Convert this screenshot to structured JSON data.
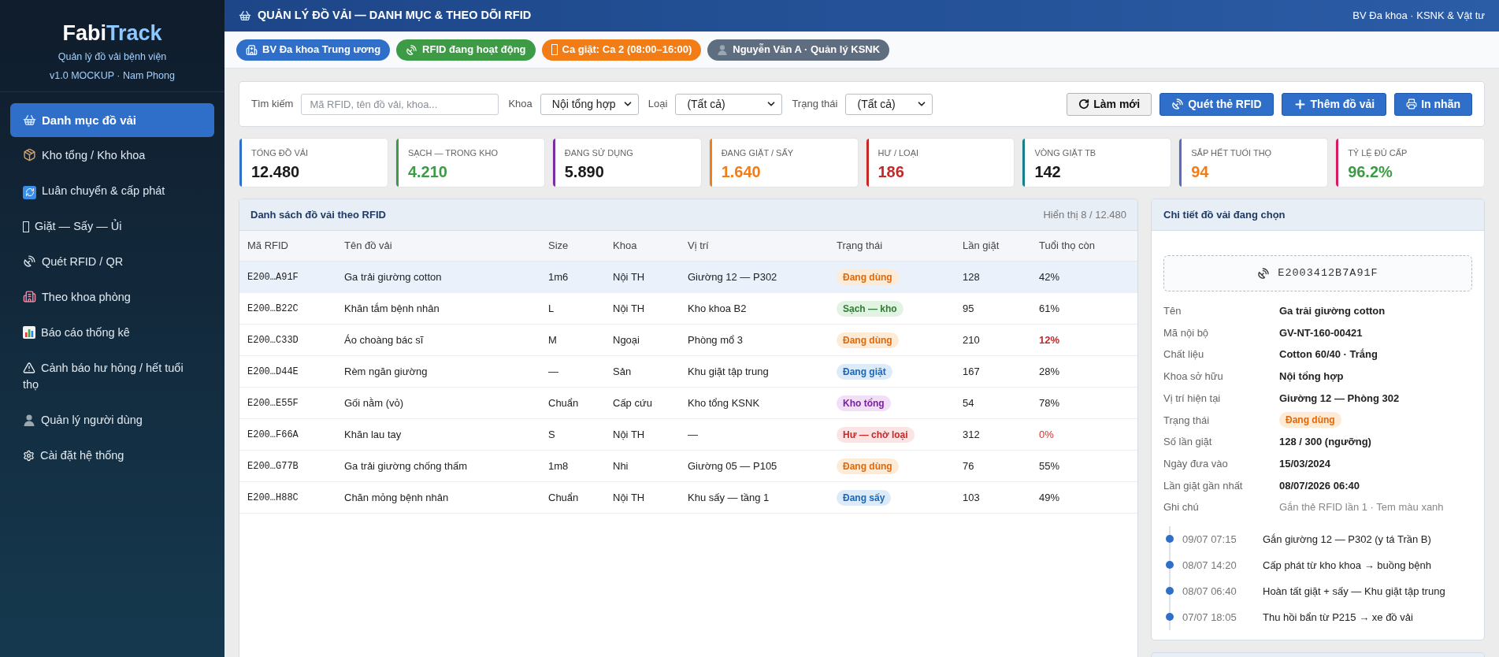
{
  "sidebar": {
    "logo": {
      "text_1": "Fabi",
      "text_2": "Track"
    },
    "subtitle": "Quản lý đồ vải bệnh viện",
    "version": "v1.0 MOCKUP · Nam Phong",
    "items": [
      {
        "label": "Danh mục đồ vải",
        "selected": true
      },
      {
        "label": "Kho tổng / Kho khoa",
        "selected": false
      },
      {
        "label": "Luân chuyển & cấp phát",
        "selected": false
      },
      {
        "label": "Giặt — Sấy — Ủi",
        "selected": false
      },
      {
        "label": "Quét RFID / QR",
        "selected": false
      },
      {
        "label": "Theo khoa phòng",
        "selected": false
      },
      {
        "label": "Báo cáo thống kê",
        "selected": false
      },
      {
        "label": "Cảnh báo hư hỏng / hết tuổi thọ",
        "selected": false
      },
      {
        "label": "Quản lý người dùng",
        "selected": false
      },
      {
        "label": "Cài đặt hệ thống",
        "selected": false
      }
    ]
  },
  "header": {
    "title": "QUẢN LÝ ĐỒ VẢI — DANH MỤC & THEO DÕI RFID",
    "context": "BV Đa khoa · KSNK & Vật tư"
  },
  "chips": [
    {
      "label": "BV Đa khoa Trung ương",
      "color": "#2f6fca"
    },
    {
      "label": "RFID đang hoạt động",
      "color": "#3d9b46"
    },
    {
      "label": "Ca giặt: Ca 2 (08:00–16:00)",
      "color": "#f27d17"
    },
    {
      "label": "Nguyễn Văn A · Quản lý KSNK",
      "color": "#5f6d80"
    }
  ],
  "filters": {
    "search": {
      "label": "Tìm kiếm",
      "placeholder": "Mã RFID, tên đồ vải, khoa..."
    },
    "selects": [
      {
        "label": "Khoa",
        "value": "Nội tổng hợp"
      },
      {
        "label": "Loại",
        "value": "(Tất cả)"
      },
      {
        "label": "Trạng thái",
        "value": "(Tất cả)"
      }
    ],
    "buttons": [
      {
        "label": "Làm mới",
        "kind": "secondary"
      },
      {
        "label": "Quét thẻ RFID",
        "kind": "primary"
      },
      {
        "label": "Thêm đồ vải",
        "kind": "primary"
      },
      {
        "label": "In nhãn",
        "kind": "primary"
      }
    ]
  },
  "stats": [
    {
      "label": "TỔNG ĐỒ VẢI",
      "value": {
        "text": "12.480",
        "color": "#1a1a1a"
      },
      "color": "#2f6fca"
    },
    {
      "label": "SẠCH — TRONG KHO",
      "value": {
        "text": "4.210",
        "color": "#3d9b46"
      },
      "color": "#3d9b46"
    },
    {
      "label": "ĐANG SỬ DỤNG",
      "value": {
        "text": "5.890",
        "color": "#1a1a1a"
      },
      "color": "#7b2fa0"
    },
    {
      "label": "ĐANG GIẶT / SẤY",
      "value": {
        "text": "1.640",
        "color": "#f27d17"
      },
      "color": "#f27d17"
    },
    {
      "label": "HƯ / LOẠI",
      "value": {
        "text": "186",
        "color": "#c62828"
      },
      "color": "#c62828"
    },
    {
      "label": "VÒNG GIẶT TB",
      "value": {
        "text": "142",
        "color": "#1a1a1a"
      },
      "color": "#15808a"
    },
    {
      "label": "SẮP HẾT TUỔI THỌ",
      "value": {
        "text": "94",
        "color": "#f27d17"
      },
      "color": "#5c6bc0"
    },
    {
      "label": "TỶ LỆ ĐỦ CẤP",
      "value": {
        "text": "96.2%",
        "color": "#3d9b46"
      },
      "color": "#d81b60"
    }
  ],
  "table": {
    "title": "Danh sách đồ vải theo RFID",
    "count": "Hiển thị 8 / 12.480",
    "columns": [
      "Mã RFID",
      "Tên đồ vải",
      "Size",
      "Khoa",
      "Vị trí",
      "Trạng thái",
      "Lần giặt",
      "Tuổi thọ còn"
    ],
    "rows": [
      {
        "rfid": "E200…A91F",
        "name": "Ga trải giường cotton",
        "size": "1m6",
        "dept": "Nội TH",
        "location": "Giường 12 — P302",
        "status": {
          "text": "Đang dùng",
          "kind": "in_use"
        },
        "washes": "128",
        "life": {
          "text": "42%",
          "kind": "normal"
        },
        "selected": true
      },
      {
        "rfid": "E200…B22C",
        "name": "Khăn tắm bệnh nhân",
        "size": "L",
        "dept": "Nội TH",
        "location": "Kho khoa B2",
        "status": {
          "text": "Sạch — kho",
          "kind": "clean"
        },
        "washes": "95",
        "life": {
          "text": "61%",
          "kind": "normal"
        },
        "selected": false
      },
      {
        "rfid": "E200…C33D",
        "name": "Áo choàng bác sĩ",
        "size": "M",
        "dept": "Ngoại",
        "location": "Phòng mổ 3",
        "status": {
          "text": "Đang dùng",
          "kind": "in_use"
        },
        "washes": "210",
        "life": {
          "text": "12%",
          "kind": "critical"
        },
        "selected": false
      },
      {
        "rfid": "E200…D44E",
        "name": "Rèm ngăn giường",
        "size": "—",
        "dept": "Sản",
        "location": "Khu giặt tập trung",
        "status": {
          "text": "Đang giặt",
          "kind": "washing"
        },
        "washes": "167",
        "life": {
          "text": "28%",
          "kind": "normal"
        },
        "selected": false
      },
      {
        "rfid": "E200…E55F",
        "name": "Gối nằm (vỏ)",
        "size": "Chuẩn",
        "dept": "Cấp cứu",
        "location": "Kho tổng KSNK",
        "status": {
          "text": "Kho tổng",
          "kind": "warehouse"
        },
        "washes": "54",
        "life": {
          "text": "78%",
          "kind": "normal"
        },
        "selected": false
      },
      {
        "rfid": "E200…F66A",
        "name": "Khăn lau tay",
        "size": "S",
        "dept": "Nội TH",
        "location": "—",
        "status": {
          "text": "Hư — chờ loại",
          "kind": "damaged"
        },
        "washes": "312",
        "life": {
          "text": "0%",
          "kind": "expired"
        },
        "selected": false
      },
      {
        "rfid": "E200…G77B",
        "name": "Ga trải giường chống thấm",
        "size": "1m8",
        "dept": "Nhi",
        "location": "Giường 05 — P105",
        "status": {
          "text": "Đang dùng",
          "kind": "in_use"
        },
        "washes": "76",
        "life": {
          "text": "55%",
          "kind": "normal"
        },
        "selected": false
      },
      {
        "rfid": "E200…H88C",
        "name": "Chăn mỏng bệnh nhân",
        "size": "Chuẩn",
        "dept": "Nội TH",
        "location": "Khu sấy — tầng 1",
        "status": {
          "text": "Đang sấy",
          "kind": "drying"
        },
        "washes": "103",
        "life": {
          "text": "49%",
          "kind": "normal"
        },
        "selected": false
      }
    ]
  },
  "detail": {
    "title": "Chi tiết đồ vải đang chọn",
    "rfid": "E2003412B7A91F",
    "fields": [
      {
        "label": "Tên",
        "value": "Ga trải giường cotton",
        "kind": "text"
      },
      {
        "label": "Mã nội bộ",
        "value": "GV-NT-160-00421",
        "kind": "text"
      },
      {
        "label": "Chất liệu",
        "value": "Cotton 60/40 · Trắng",
        "kind": "text"
      },
      {
        "label": "Khoa sở hữu",
        "value": "Nội tổng hợp",
        "kind": "text"
      },
      {
        "label": "Vị trí hiện tại",
        "value": "Giường 12 — Phòng 302",
        "kind": "text"
      },
      {
        "label": "Trạng thái",
        "status": {
          "text": "Đang dùng",
          "kind": "in_use"
        },
        "kind": "badge"
      },
      {
        "label": "Số lần giặt",
        "value": "128 / 300 (ngưỡng)",
        "kind": "text"
      },
      {
        "label": "Ngày đưa vào",
        "value": "15/03/2024",
        "kind": "text"
      },
      {
        "label": "Lần giặt gần nhất",
        "value": "08/07/2026 06:40",
        "kind": "text"
      },
      {
        "label": "Ghi chú",
        "value": "Gắn thẻ RFID lần 1 · Tem màu xanh",
        "kind": "note"
      }
    ],
    "timeline": [
      {
        "time": "09/07 07:15",
        "event": "Gắn giường 12 — P302 (y tá Trần B)"
      },
      {
        "time": "08/07 14:20",
        "event": "Cấp phát từ kho khoa → buồng bệnh"
      },
      {
        "time": "08/07 06:40",
        "event": "Hoàn tất giặt + sấy — Khu giặt tập trung"
      },
      {
        "time": "07/07 18:05",
        "event": "Thu hồi bẩn từ P215 → xe đồ vải"
      }
    ]
  }
}
